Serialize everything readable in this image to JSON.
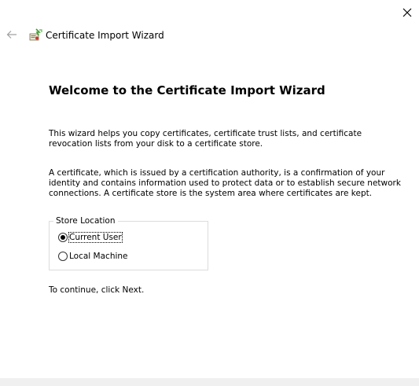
{
  "window": {
    "title": "Certificate Import Wizard",
    "title_icon": "certificate-wizard-icon",
    "close_icon": "close-icon",
    "back_icon": "back-arrow-icon"
  },
  "main": {
    "heading": "Welcome to the Certificate Import Wizard",
    "paragraph1": "This wizard helps you copy certificates, certificate trust lists, and certificate revocation lists from your disk to a certificate store.",
    "paragraph2": "A certificate, which is issued by a certification authority, is a confirmation of your identity and contains information used to protect data or to establish secure network connections. A certificate store is the system area where certificates are kept.",
    "store_location": {
      "legend": "Store Location",
      "options": [
        {
          "label": "Current User",
          "selected": true
        },
        {
          "label": "Local Machine",
          "selected": false
        }
      ]
    },
    "continue_text": "To continue, click Next."
  },
  "colors": {
    "background": "#ffffff",
    "footer": "#f0f0f0",
    "groupbox_border": "#dcdcdc"
  }
}
